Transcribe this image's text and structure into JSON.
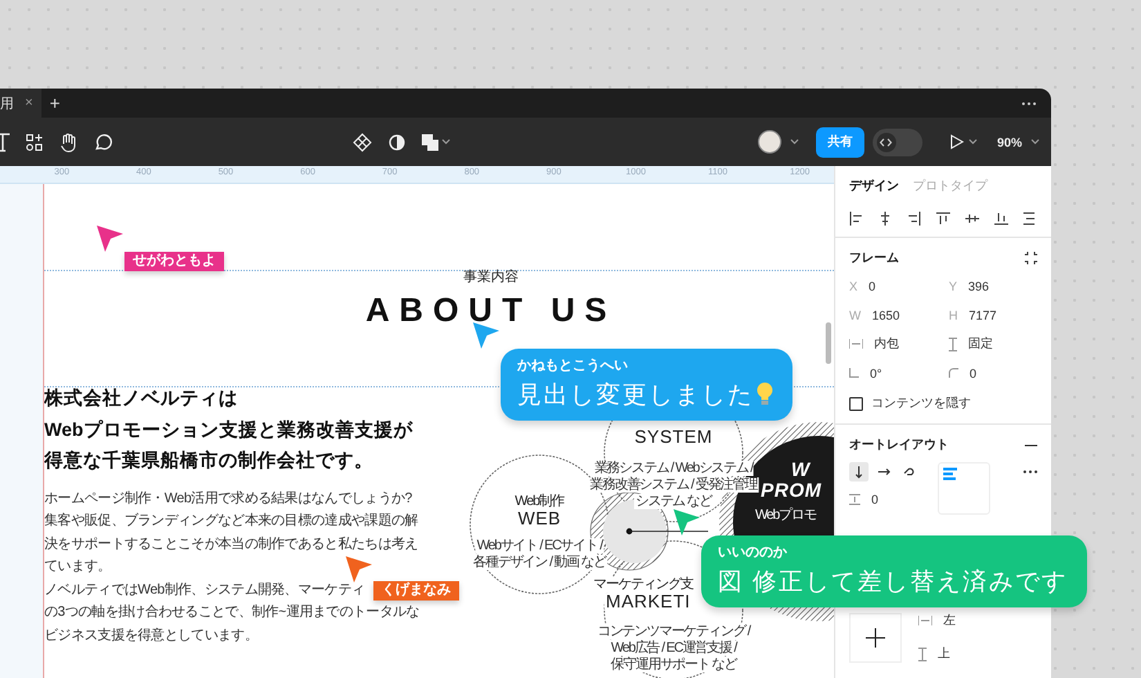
{
  "tabbar": {
    "tab": "用",
    "close": "×",
    "add": "+"
  },
  "toolbar": {
    "share": "共有",
    "dev_mode": {
      "on": false
    },
    "zoom": "90%"
  },
  "ruler": {
    "marks": [
      "300",
      "400",
      "500",
      "600",
      "700",
      "800",
      "900",
      "1000",
      "1100",
      "1200"
    ]
  },
  "canvas": {
    "subheading": "事業内容",
    "heading": "ABOUT US",
    "lead": [
      "株式会社ノベルティは",
      "Webプロモーション支援と業務改善支援が",
      "得意な千葉県船橋市の制作会社です。"
    ],
    "paragraphs": [
      [
        "ホームページ制作・Web活用で求める結果はなんでしょうか?",
        "集客や販促、ブランディングなど本来の目標の達成や課題の解",
        "決をサポートすることこそが本当の制作であると私たちは考え",
        "ています。"
      ],
      [
        "ノベルティではWeb制作、システム開発、マーケティ",
        "の3つの軸を掛け合わせることで、制作~運用までのトータルな",
        "ビジネス支援を得意としています。"
      ]
    ],
    "diagram": [
      {
        "kind": "web",
        "texts": [
          {
            "kind": "caption",
            "text": "Web制作"
          },
          {
            "kind": "title",
            "text": "WEB"
          },
          {
            "kind": "desc",
            "text": "Webサイト / ECサイト /"
          },
          {
            "kind": "desc",
            "text": "各種デザイン / 動画 など"
          }
        ]
      },
      {
        "kind": "system",
        "texts": [
          {
            "kind": "title",
            "text": "SYSTEM"
          },
          {
            "kind": "desc",
            "text": "業務システム / Webシステム /"
          },
          {
            "kind": "desc",
            "text": "業務改善システム / 受発注管理"
          },
          {
            "kind": "desc",
            "text": "システム など"
          }
        ]
      },
      {
        "kind": "marketing",
        "texts": [
          {
            "kind": "caption",
            "text": "マーケティング支"
          },
          {
            "kind": "title",
            "text": "MARKETI"
          },
          {
            "kind": "desc",
            "text": "コンテンツマーケティング /"
          },
          {
            "kind": "desc",
            "text": "Web広告 / EC運営支援 /"
          },
          {
            "kind": "desc",
            "text": "保守運用サポート など"
          }
        ]
      },
      {
        "kind": "promotion",
        "texts": [
          {
            "kind": "title",
            "text": "W"
          },
          {
            "kind": "title",
            "text": "PROM"
          },
          {
            "kind": "desc",
            "text": "Webプロモ"
          }
        ]
      }
    ]
  },
  "collaborators": [
    {
      "kind": "tag",
      "name": "せがわともよ",
      "color": "#e8318a"
    },
    {
      "kind": "comment",
      "name": "かねもとこうへい",
      "message": "見出し変更しました",
      "color": "#1ea7ef"
    },
    {
      "kind": "tag",
      "name": "くげまなみ",
      "color": "#f0621e"
    },
    {
      "kind": "comment",
      "name": "いいののか",
      "message": "図 修正して差し替え済みです",
      "color": "#15c480"
    }
  ],
  "panel": {
    "tabs": [
      {
        "label": "デザイン",
        "selected": true
      },
      {
        "label": "プロトタイプ",
        "selected": false
      }
    ],
    "frame": {
      "title": "フレーム",
      "fields": [
        {
          "label": "X",
          "value": "0"
        },
        {
          "label": "Y",
          "value": "396"
        },
        {
          "label": "W",
          "value": "1650"
        },
        {
          "label": "H",
          "value": "7177"
        }
      ],
      "width_mode": "内包",
      "height_mode": "固定",
      "rotation": "0°",
      "radius": "0",
      "clip": {
        "label": "コンテンツを隠す",
        "checked": false
      }
    },
    "auto_layout": {
      "title": "オートレイアウト",
      "directions": [
        {
          "kind": "vertical",
          "selected": true
        },
        {
          "kind": "horizontal",
          "selected": false
        },
        {
          "kind": "wrap",
          "selected": false
        }
      ],
      "gap": "0"
    },
    "constraints": {
      "horizontal": "左",
      "vertical": "上"
    }
  }
}
